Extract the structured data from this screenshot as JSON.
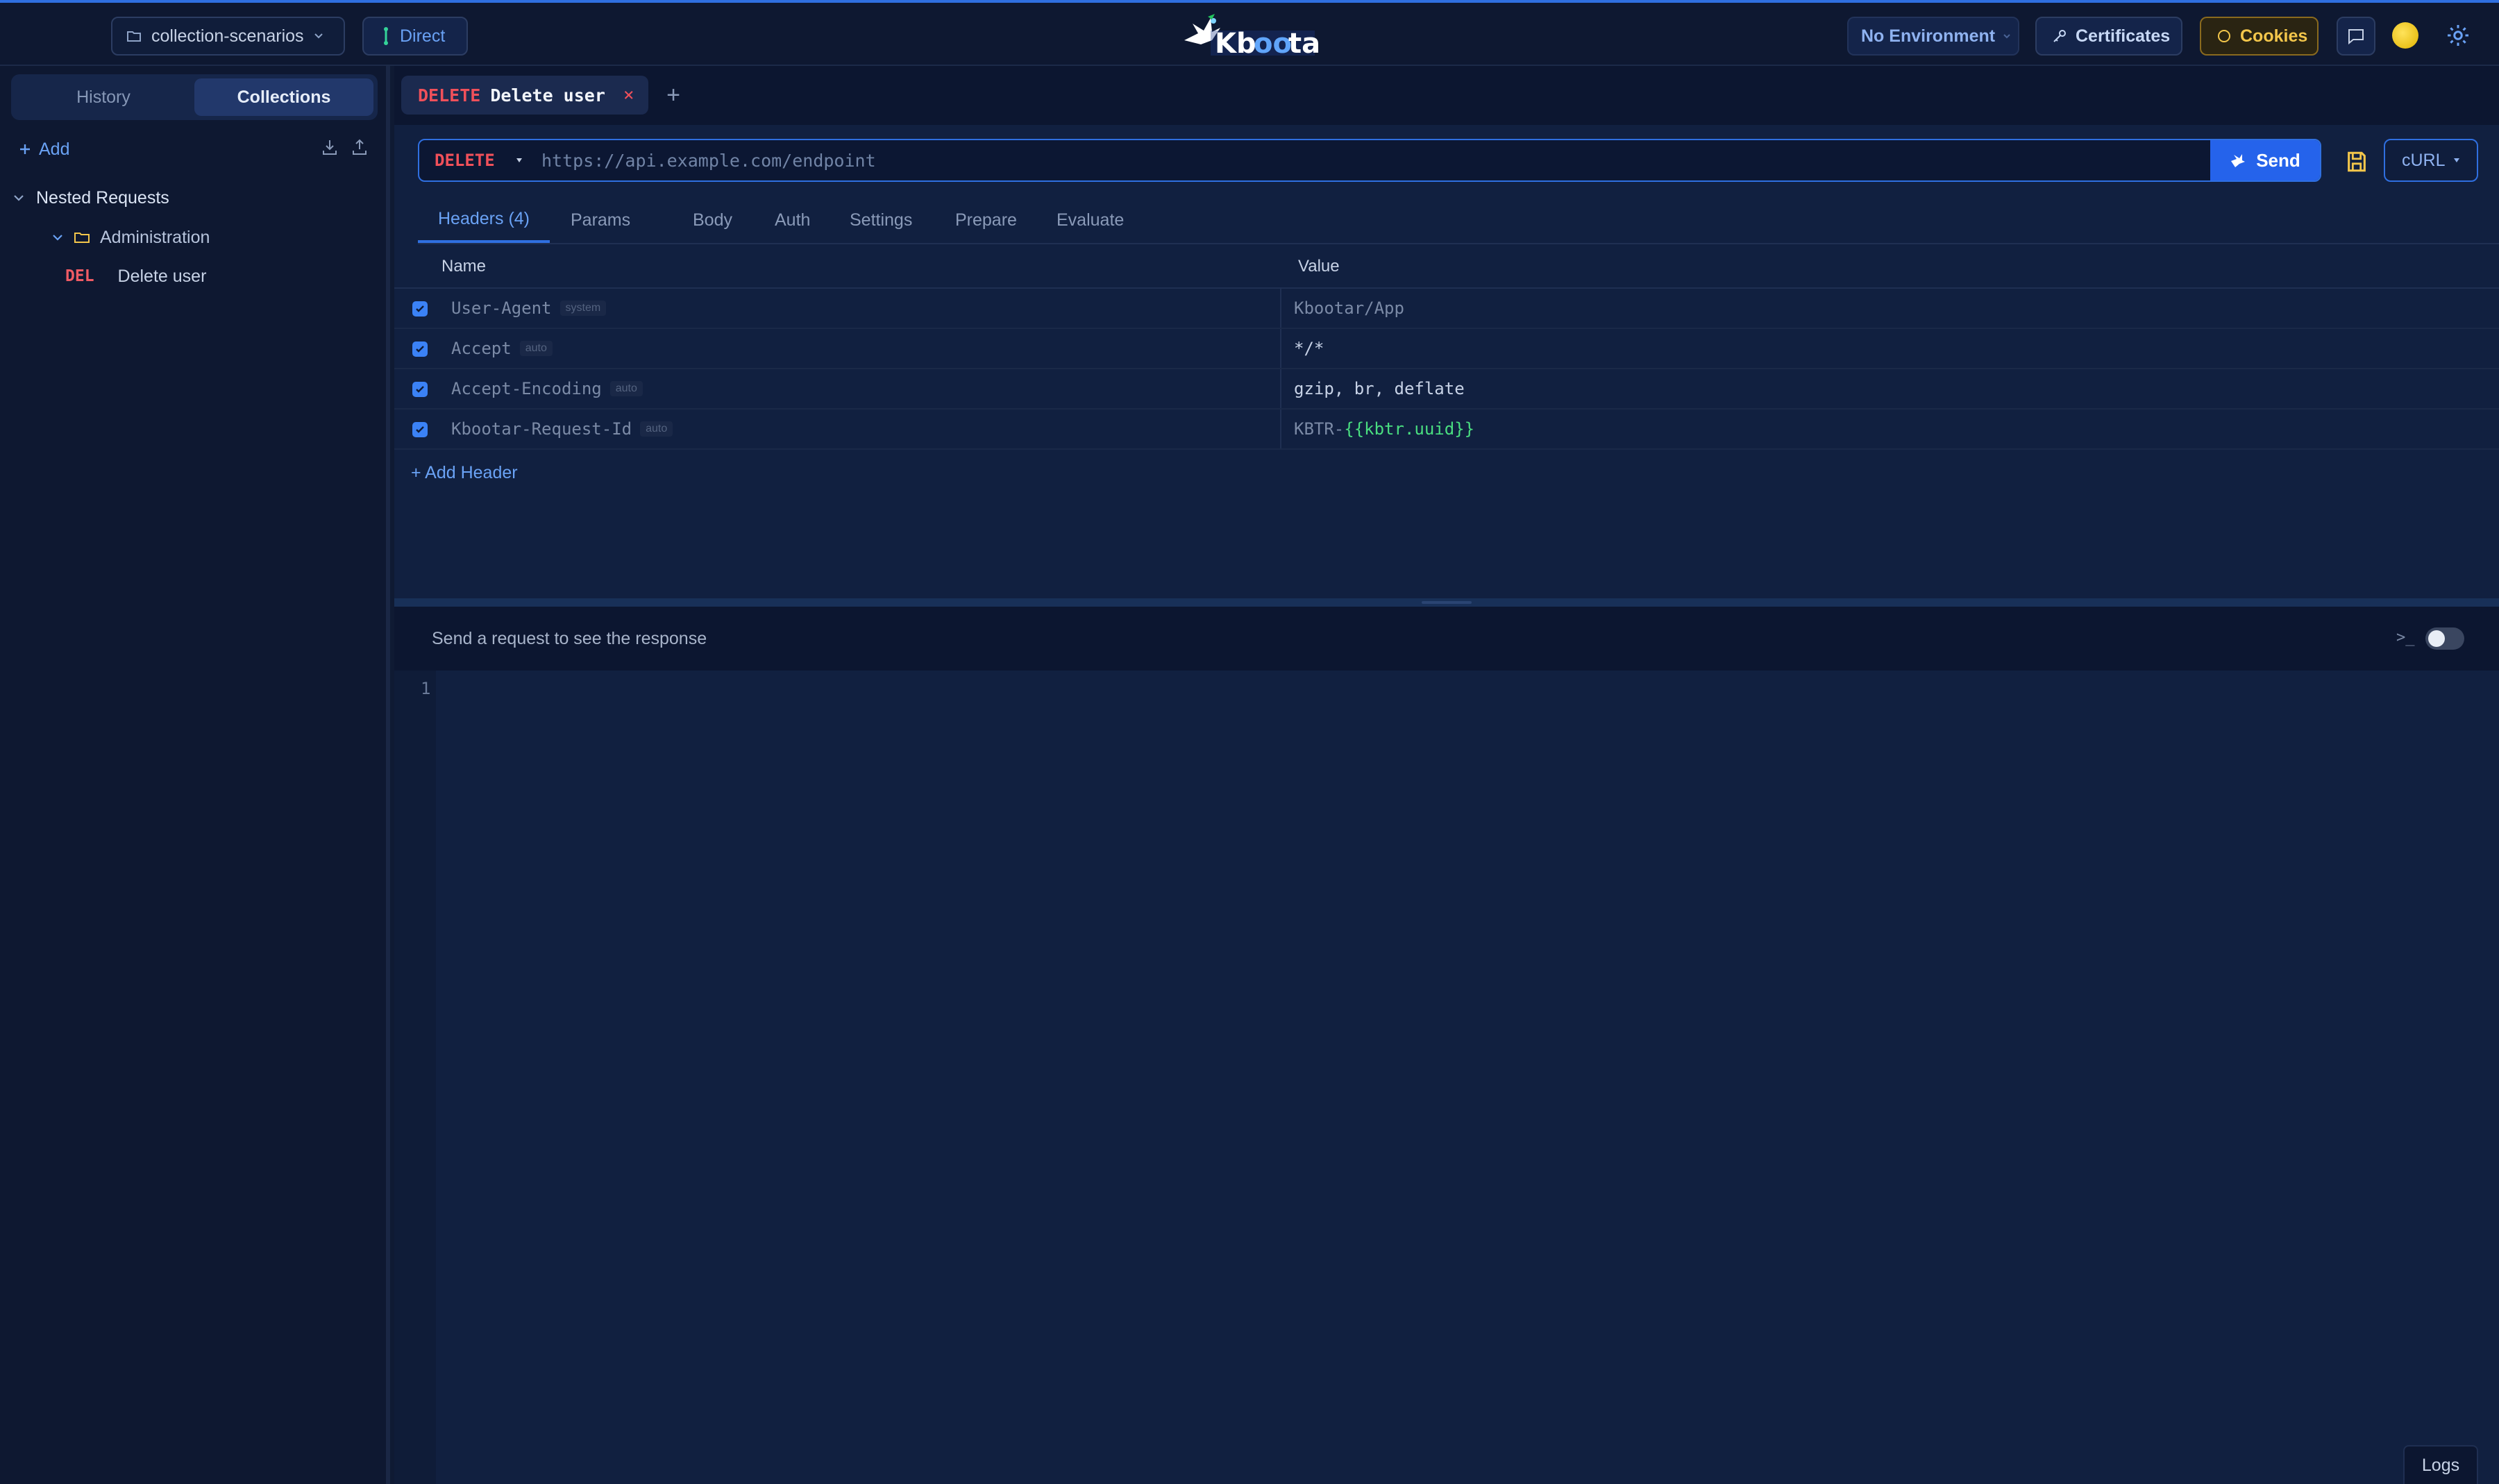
{
  "topbar": {
    "collection": "collection-scenarios",
    "direct": "Direct",
    "logo": "Kbootar",
    "environment": "No Environment",
    "certificates": "Certificates",
    "cookies": "Cookies"
  },
  "sidebar": {
    "tabs": [
      "History",
      "Collections"
    ],
    "active_tab": "Collections",
    "add_label": "Add",
    "tree": {
      "root": "Nested Requests",
      "folder": "Administration",
      "request": {
        "method": "DEL",
        "name": "Delete user"
      }
    }
  },
  "request_tab": {
    "method": "DELETE",
    "name": "Delete user",
    "close": "×",
    "new": "+"
  },
  "request": {
    "method": "DELETE",
    "url_placeholder": "https://api.example.com/endpoint",
    "send_label": "Send",
    "export_format": "cURL"
  },
  "editor_tabs": [
    "Headers (4)",
    "Params",
    "Body",
    "Auth",
    "Settings",
    "Prepare",
    "Evaluate"
  ],
  "active_editor_tab": "Headers (4)",
  "headers": {
    "columns": [
      "Name",
      "Value"
    ],
    "rows": [
      {
        "enabled": true,
        "name": "User-Agent",
        "badge": "system",
        "value": "Kbootar/App"
      },
      {
        "enabled": true,
        "name": "Accept",
        "badge": "auto",
        "value": "*/*"
      },
      {
        "enabled": true,
        "name": "Accept-Encoding",
        "badge": "auto",
        "value": "gzip, br, deflate"
      },
      {
        "enabled": true,
        "name": "Kbootar-Request-Id",
        "badge": "auto",
        "value_prefix": "KBTR-",
        "value_var": "{{kbtr.uuid}}"
      }
    ],
    "add_label": "+ Add Header"
  },
  "response": {
    "placeholder": "Send a request to see the response",
    "terminal_glyph": ">_",
    "line_number": "1",
    "logs_label": "Logs"
  },
  "colors": {
    "accent": "#2563eb",
    "delete_method": "#f0505a",
    "cookies": "#f3c64b",
    "variable": "#4ade80"
  }
}
